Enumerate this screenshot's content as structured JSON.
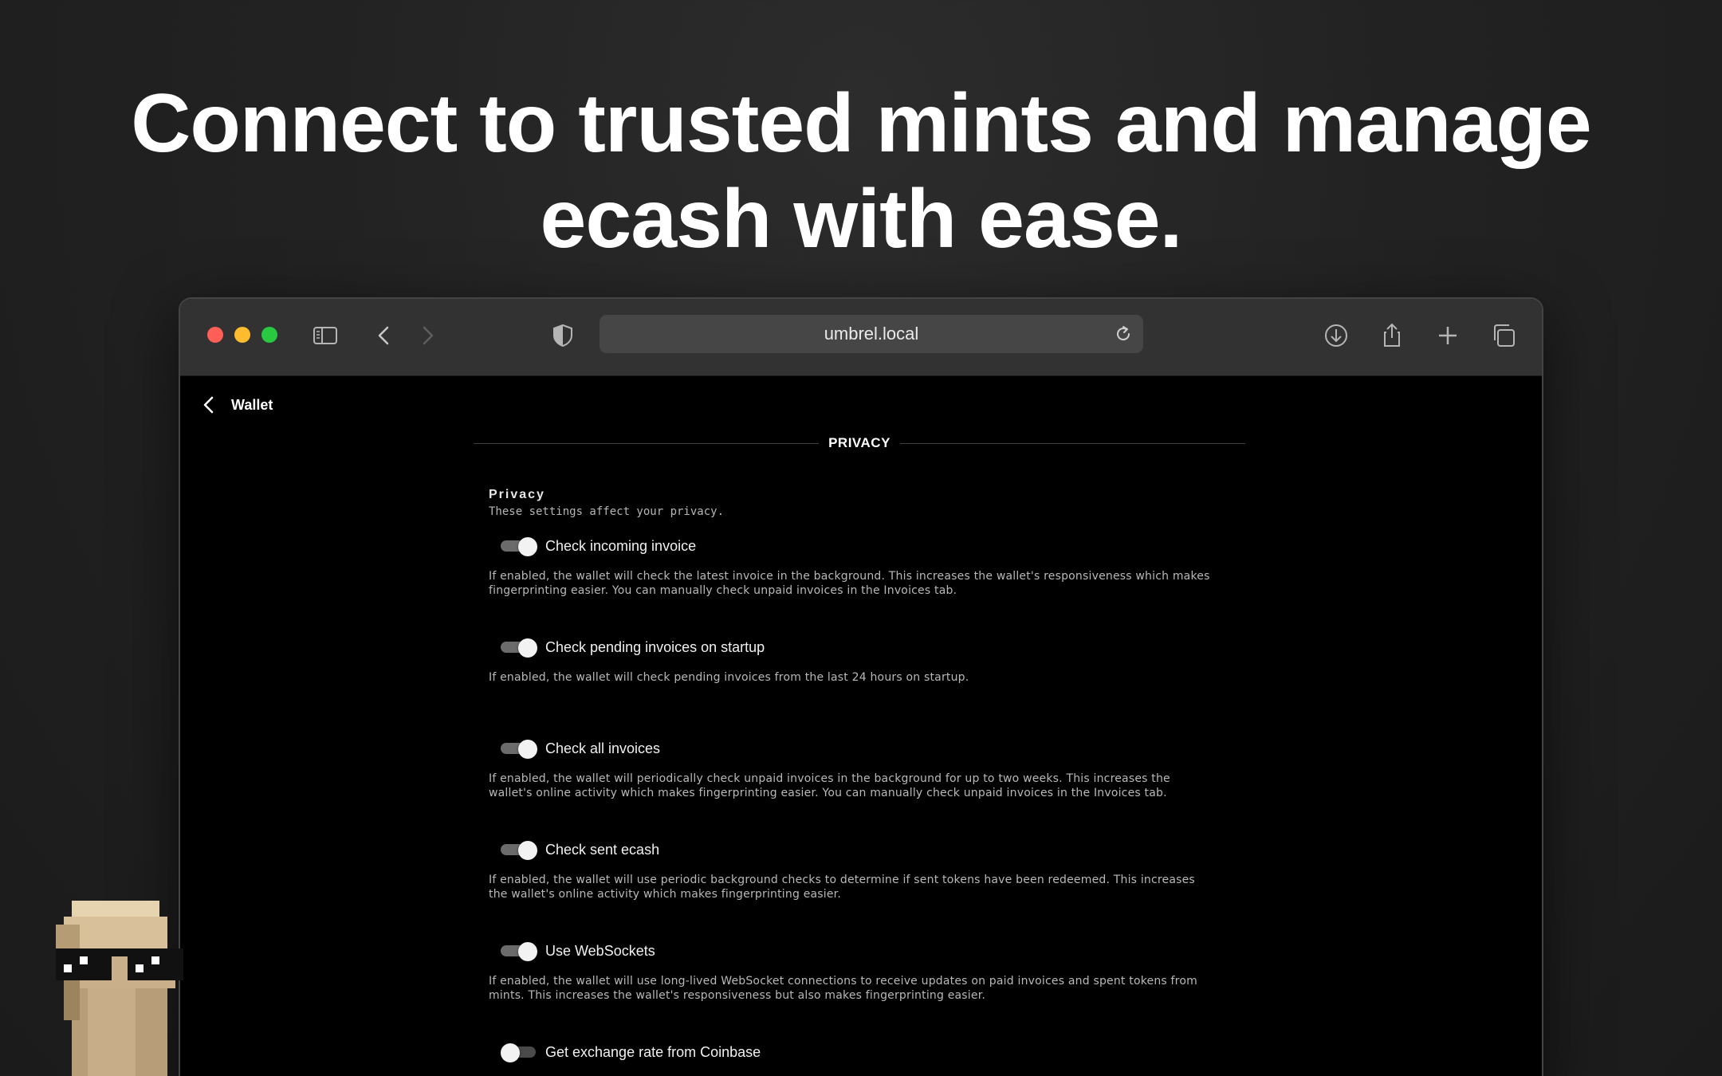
{
  "headline": {
    "line1": "Connect to trusted mints and manage",
    "line2": "ecash with ease."
  },
  "browser": {
    "url": "umbrel.local",
    "toolbar_icons": [
      "sidebar-icon",
      "back-icon",
      "forward-icon",
      "shield-icon",
      "reload-icon",
      "download-icon",
      "share-icon",
      "new-tab-icon",
      "tabs-overview-icon"
    ]
  },
  "page": {
    "back_label": "Wallet",
    "section_label": "PRIVACY",
    "group_title": "Privacy",
    "group_subtitle": "These settings affect your privacy.",
    "settings": [
      {
        "label": "Check incoming invoice",
        "enabled": true,
        "description_line1": "If enabled, the wallet will check the latest invoice in the background. This increases the wallet's responsiveness which makes",
        "description_line2": "fingerprinting easier. You can manually check unpaid invoices in the Invoices tab."
      },
      {
        "label": "Check pending invoices on startup",
        "enabled": true,
        "description_line1": "If enabled, the wallet will check pending invoices from the last 24 hours on startup.",
        "description_line2": ""
      },
      {
        "label": "Check all invoices",
        "enabled": true,
        "description_line1": "If enabled, the wallet will periodically check unpaid invoices in the background for up to two weeks. This increases the",
        "description_line2": "wallet's online activity which makes fingerprinting easier. You can manually check unpaid invoices in the Invoices tab."
      },
      {
        "label": "Check sent ecash",
        "enabled": true,
        "description_line1": "If enabled, the wallet will use periodic background checks to determine if sent tokens have been redeemed. This increases",
        "description_line2": "the wallet's online activity which makes fingerprinting easier."
      },
      {
        "label": "Use WebSockets",
        "enabled": true,
        "description_line1": "If enabled, the wallet will use long-lived WebSocket connections to receive updates on paid invoices and spent tokens from",
        "description_line2": "mints. This increases the wallet's responsiveness but also makes fingerprinting easier."
      },
      {
        "label": "Get exchange rate from Coinbase",
        "enabled": false,
        "description_line1": "",
        "description_line2": ""
      }
    ]
  },
  "colors": {
    "traffic_red": "#ff5f57",
    "traffic_yellow": "#febc2e",
    "traffic_green": "#28c840",
    "toolbar_bg": "#323232",
    "content_bg": "#000000"
  }
}
